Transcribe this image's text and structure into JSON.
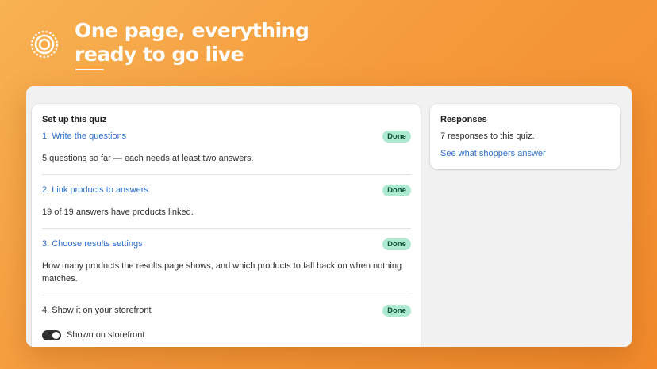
{
  "hero": {
    "title_line1": "One page, everything",
    "title_line2": "ready to go live"
  },
  "setup": {
    "title": "Set up this quiz",
    "steps": [
      {
        "label": "1. Write the questions",
        "status": "Done",
        "description": "5 questions so far — each needs at least two answers."
      },
      {
        "label": "2. Link products to answers",
        "status": "Done",
        "description": "19 of 19 answers have products linked."
      },
      {
        "label": "3. Choose results settings",
        "status": "Done",
        "description": "How many products the results page shows, and which products to fall back on when nothing matches."
      },
      {
        "label": "4. Show it on your storefront",
        "status": "Done",
        "toggle_label": "Shown on storefront",
        "toggle_on": true
      }
    ]
  },
  "responses": {
    "title": "Responses",
    "summary": "7 responses to this quiz.",
    "link": "See what shoppers answer"
  },
  "colors": {
    "link": "#2c6ecb",
    "badge_bg": "#aee9d1",
    "badge_text": "#0c5132",
    "background_start": "#f8b251",
    "background_end": "#f28a2c"
  }
}
